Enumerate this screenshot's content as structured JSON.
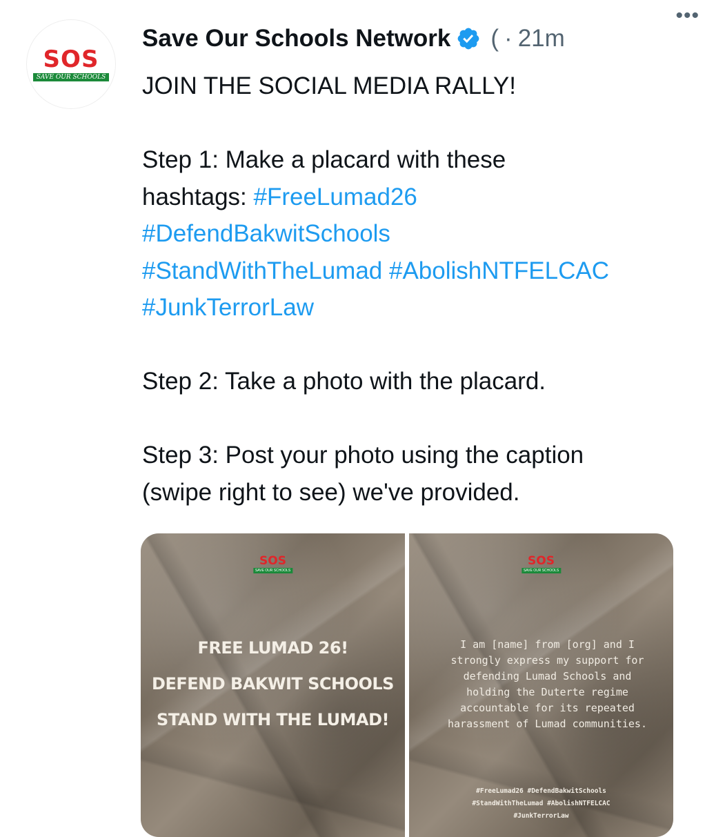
{
  "author": {
    "name": "Save Our Schools Network",
    "handle": "(",
    "separator": "·",
    "time": "21m",
    "more": "•••",
    "logo_letters": "SOS",
    "logo_sub": "SAVE OUR SCHOOLS"
  },
  "tweet": {
    "line1": "JOIN THE SOCIAL MEDIA RALLY!",
    "step1_a": "Step 1: Make a placard with these",
    "step1_b": "hashtags: ",
    "hashtags": [
      "#FreeLumad26",
      "#DefendBakwitSchools",
      "#StandWithTheLumad",
      "#AbolishNTFELCAC",
      "#JunkTerrorLaw"
    ],
    "step2": "Step 2: Take a photo with the placard.",
    "step3_a": "Step 3: Post your photo using the caption",
    "step3_b": "(swipe right to see) we've provided."
  },
  "media": {
    "card1": {
      "logo_letters": "SOS",
      "logo_sub": "SAVE OUR SCHOOLS",
      "slogans": [
        "FREE LUMAD 26!",
        "DEFEND BAKWIT SCHOOLS",
        "STAND WITH THE LUMAD!"
      ]
    },
    "card2": {
      "logo_letters": "SOS",
      "logo_sub": "SAVE OUR SCHOOLS",
      "caption_lines": [
        "I am [name] from [org] and I",
        "strongly express my support for",
        "defending Lumad Schools and",
        "holding the Duterte regime",
        "accountable for its repeated",
        "harassment of Lumad communities."
      ],
      "tag_lines": [
        "#FreeLumad26 #DefendBakwitSchools",
        "#StandWithTheLumad #AbolishNTFELCAC",
        "#JunkTerrorLaw"
      ]
    }
  },
  "colors": {
    "link": "#1d9bf0",
    "verified": "#1d9bf0",
    "muted": "#536471",
    "logo_red": "#e0262a",
    "logo_green": "#1b8a3a"
  },
  "icons": [
    "verified-badge-icon",
    "more-options-icon"
  ]
}
